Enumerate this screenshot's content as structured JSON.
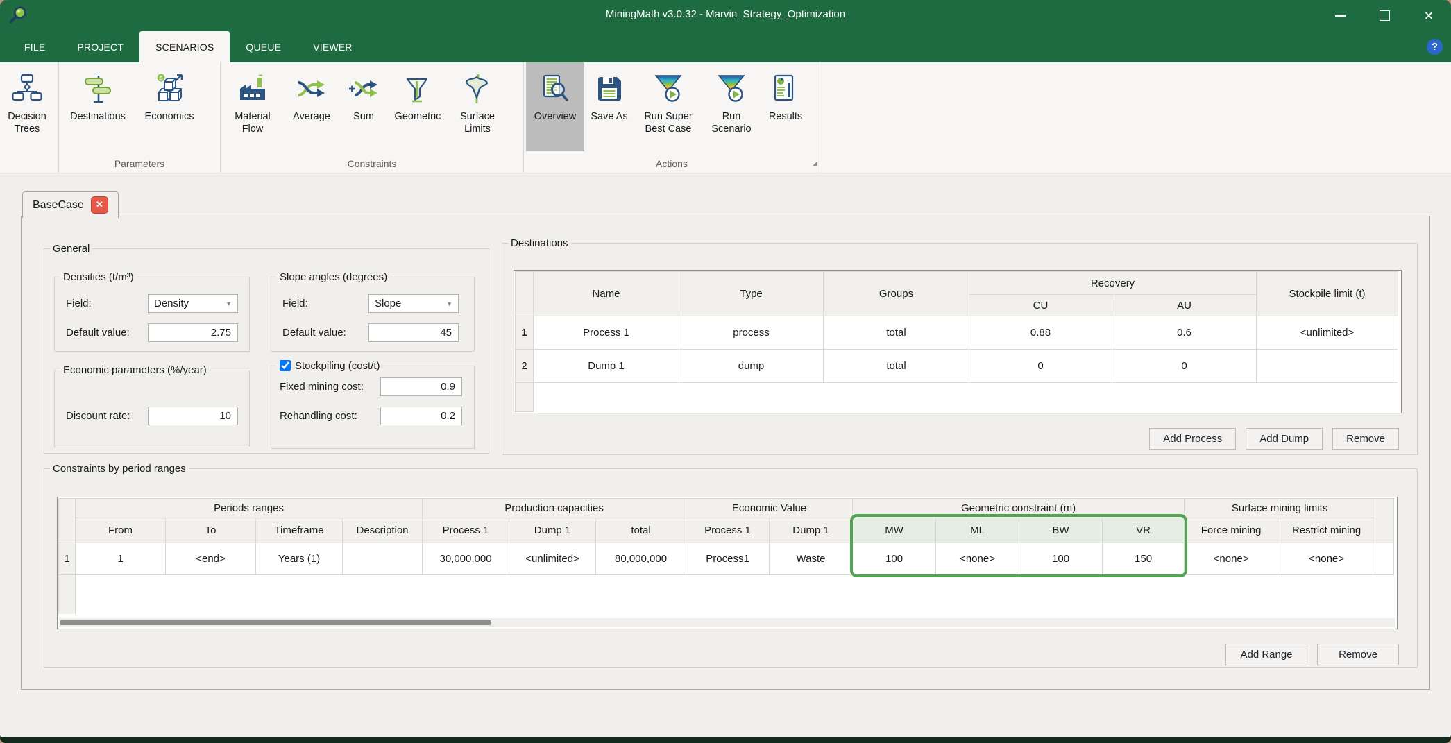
{
  "window": {
    "title": "MiningMath v3.0.32 - Marvin_Strategy_Optimization"
  },
  "icons": {
    "window_close": "✕",
    "tab_close": "✕",
    "help": "?",
    "combo_arrow": "▼",
    "dialog_launcher": "◢"
  },
  "colors": {
    "titlebar_green": "#1e6b41",
    "highlight_border_green": "#52a553",
    "highlight_fill_green": "#ecf4ea",
    "unlimited_fill_green": "#d8ecda",
    "close_red": "#e4594a",
    "help_blue": "#2a67cf"
  },
  "menu": {
    "items": [
      {
        "label": "FILE"
      },
      {
        "label": "PROJECT"
      },
      {
        "label": "SCENARIOS"
      },
      {
        "label": "QUEUE"
      },
      {
        "label": "VIEWER"
      }
    ]
  },
  "toolbar": {
    "groups": [
      {
        "caption": "",
        "items": [
          {
            "label": "Decision Trees"
          }
        ]
      },
      {
        "caption": "Parameters",
        "items": [
          {
            "label": "Destinations"
          },
          {
            "label": "Economics"
          }
        ]
      },
      {
        "caption": "Constraints",
        "items": [
          {
            "label": "Material Flow"
          },
          {
            "label": "Average"
          },
          {
            "label": "Sum"
          },
          {
            "label": "Geometric"
          },
          {
            "label": "Surface Limits"
          }
        ]
      },
      {
        "caption": "Actions",
        "items": [
          {
            "label": "Overview"
          },
          {
            "label": "Save As"
          },
          {
            "label": "Run Super Best Case"
          },
          {
            "label": "Run Scenario"
          },
          {
            "label": "Results"
          }
        ]
      }
    ]
  },
  "tabs": [
    {
      "label": "BaseCase"
    }
  ],
  "general": {
    "legend": "General",
    "densities": {
      "legend": "Densities (t/m³)",
      "field_label": "Field:",
      "field_value": "Density",
      "default_label": "Default value:",
      "default_value": "2.75"
    },
    "slope": {
      "legend": "Slope angles (degrees)",
      "field_label": "Field:",
      "field_value": "Slope",
      "default_label": "Default value:",
      "default_value": "45"
    },
    "economic": {
      "legend": "Economic parameters (%/year)",
      "discount_label": "Discount rate:",
      "discount_value": "10"
    },
    "stockpiling": {
      "legend": "Stockpiling (cost/t)",
      "checked": "checked",
      "fixed_label": "Fixed mining cost:",
      "fixed_value": "0.9",
      "rehandling_label": "Rehandling cost:",
      "rehandling_value": "0.2"
    }
  },
  "destinations": {
    "legend": "Destinations",
    "headers": {
      "name": "Name",
      "type": "Type",
      "groups": "Groups",
      "recovery": "Recovery",
      "cu": "CU",
      "au": "AU",
      "stockpile": "Stockpile limit (t)"
    },
    "rows": [
      {
        "num": "1",
        "name": "Process 1",
        "type": "process",
        "groups": "total",
        "cu": "0.88",
        "au": "0.6",
        "stockpile": "<unlimited>"
      },
      {
        "num": "2",
        "name": "Dump 1",
        "type": "dump",
        "groups": "total",
        "cu": "0",
        "au": "0",
        "stockpile": ""
      }
    ],
    "buttons": {
      "add_process": "Add Process",
      "add_dump": "Add Dump",
      "remove": "Remove"
    }
  },
  "constraints": {
    "legend": "Constraints by period ranges",
    "group_headers": {
      "periods": "Periods ranges",
      "production": "Production capacities",
      "economic": "Economic Value",
      "geometric": "Geometric constraint (m)",
      "surface": "Surface mining limits"
    },
    "sub_headers": {
      "from": "From",
      "to": "To",
      "timeframe": "Timeframe",
      "description": "Description",
      "prod_process1": "Process 1",
      "prod_dump1": "Dump 1",
      "prod_total": "total",
      "ev_process1": "Process 1",
      "ev_dump1": "Dump 1",
      "mw": "MW",
      "ml": "ML",
      "bw": "BW",
      "vr": "VR",
      "force": "Force mining",
      "restrict": "Restrict mining"
    },
    "row": {
      "num": "1",
      "from": "1",
      "to": "<end>",
      "timeframe": "Years (1)",
      "description": "",
      "prod_process1": "30,000,000",
      "prod_dump1": "<unlimited>",
      "prod_total": "80,000,000",
      "ev_process1": "Process1",
      "ev_dump1": "Waste",
      "mw": "100",
      "ml": "<none>",
      "bw": "100",
      "vr": "150",
      "force": "<none>",
      "restrict": "<none>"
    },
    "buttons": {
      "add_range": "Add Range",
      "remove": "Remove"
    }
  }
}
